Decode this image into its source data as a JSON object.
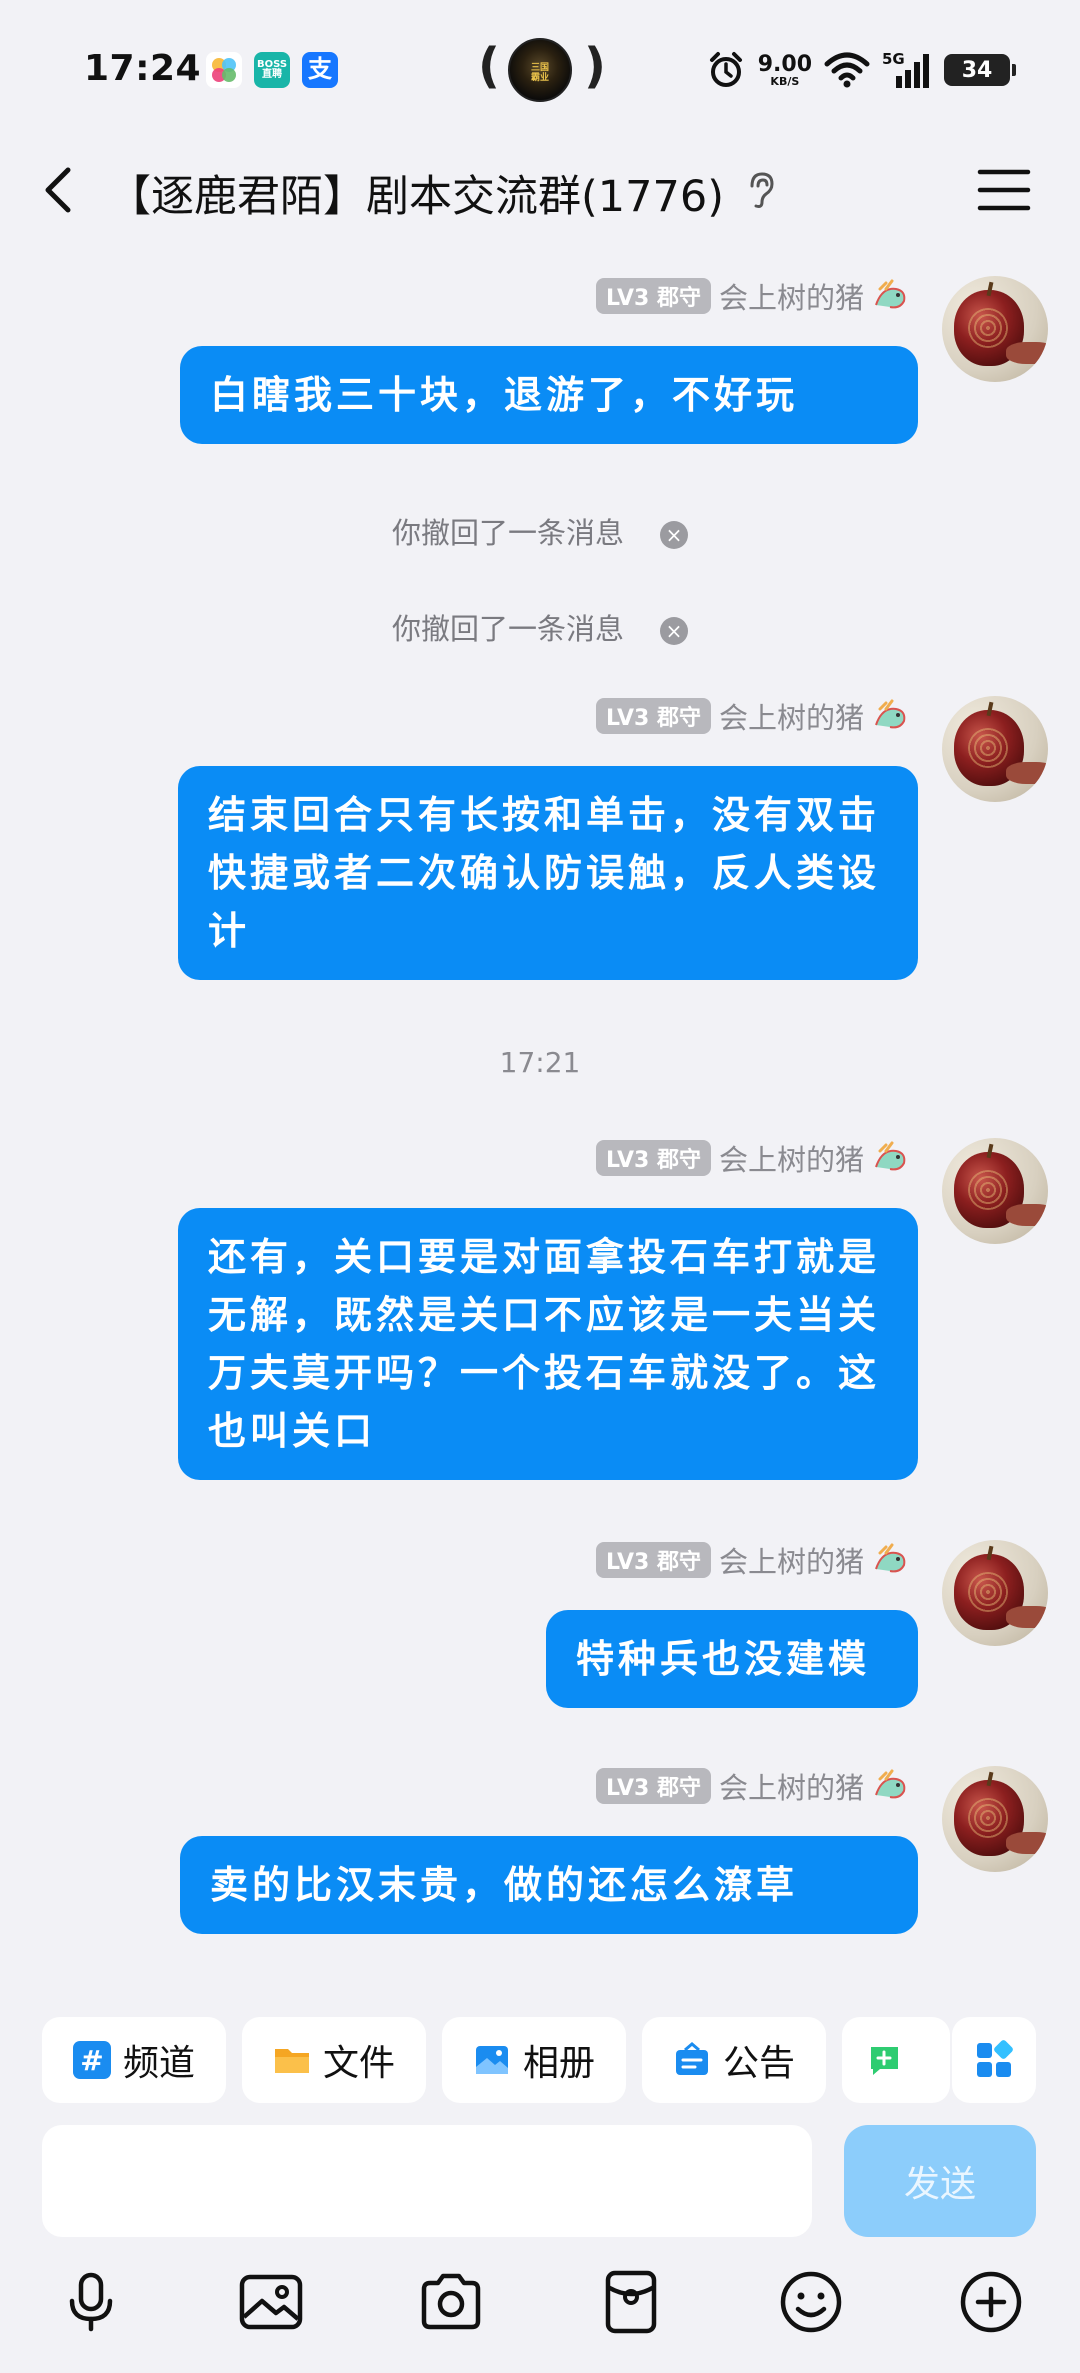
{
  "status_bar": {
    "time": "17:24",
    "apps": [
      {
        "icon": "photos-app-icon",
        "text": ""
      },
      {
        "icon": "boss-zhipin-app-icon",
        "text": "BOSS\n直聘"
      },
      {
        "icon": "alipay-app-icon",
        "text": "支"
      }
    ],
    "live_activity_text": "三国\n战国\n霸业",
    "speed_value": "9.00",
    "speed_unit": "KB/S",
    "network": "5G",
    "battery": "34"
  },
  "header": {
    "title": "【逐鹿君陌】剧本交流群(1776)"
  },
  "messages": [
    {
      "type": "outgoing",
      "level": "LV3 郡守",
      "nick": "会上树的猪",
      "text": "白瞎我三十块，退游了，不好玩"
    },
    {
      "type": "system",
      "text": "你撤回了一条消息"
    },
    {
      "type": "system",
      "text": "你撤回了一条消息"
    },
    {
      "type": "outgoing",
      "level": "LV3 郡守",
      "nick": "会上树的猪",
      "text": "结束回合只有长按和单击，没有双击快捷或者二次确认防误触，反人类设计"
    },
    {
      "type": "time",
      "text": "17:21"
    },
    {
      "type": "outgoing",
      "level": "LV3 郡守",
      "nick": "会上树的猪",
      "text": "还有，关口要是对面拿投石车打就是无解，既然是关口不应该是一夫当关万夫莫开吗？一个投石车就没了。这也叫关口"
    },
    {
      "type": "outgoing",
      "level": "LV3 郡守",
      "nick": "会上树的猪",
      "text": "特种兵也没建模"
    },
    {
      "type": "outgoing",
      "level": "LV3 郡守",
      "nick": "会上树的猪",
      "text": "卖的比汉末贵，做的还怎么潦草"
    }
  ],
  "quick_actions": [
    {
      "label": "频道",
      "icon": "hashtag-icon"
    },
    {
      "label": "文件",
      "icon": "folder-icon"
    },
    {
      "label": "相册",
      "icon": "album-icon"
    },
    {
      "label": "公告",
      "icon": "announcement-icon"
    }
  ],
  "input": {
    "placeholder": "",
    "send_label": "发送"
  },
  "colors": {
    "bubble": "#0a8cf5",
    "background": "#f2f2f6",
    "send_disabled": "#8ccdfb"
  }
}
